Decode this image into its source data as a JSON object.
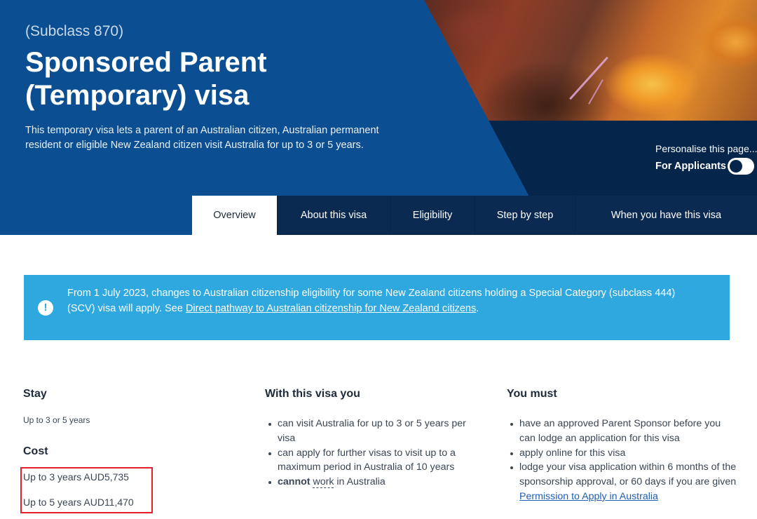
{
  "hero": {
    "subclass": "(Subclass 870)",
    "title": "Sponsored Parent (Temporary) visa",
    "description": "This temporary visa lets a parent of an Australian citizen, Australian permanent resident or eligible New Zealand citizen visit Australia for up to 3 or 5 years.",
    "personalise": "Personalise this page...",
    "audience_label": "For Applicants"
  },
  "tabs": [
    {
      "label": "Overview",
      "active": true
    },
    {
      "label": "About this visa",
      "active": false
    },
    {
      "label": "Eligibility",
      "active": false
    },
    {
      "label": "Step by step",
      "active": false
    },
    {
      "label": "When you have this visa",
      "active": false
    }
  ],
  "alert": {
    "icon": "exclamation-icon",
    "text": "From 1 July 2023, changes to Australian citizenship eligibility for some New Zealand citizens holding a Special Category (subclass 444) (SCV) visa will apply. See ",
    "link": "Direct pathway to Australian citizenship for New Zealand citizens",
    "suffix": "."
  },
  "stay": {
    "heading": "Stay",
    "value": "Up to 3 or 5 years"
  },
  "cost": {
    "heading": "Cost",
    "lines": [
      "Up to 3 years AUD5,735",
      "Up to 5 years AUD11,470"
    ]
  },
  "with_visa": {
    "heading": "With this visa you",
    "items": [
      "can visit Australia for up to 3 or 5 years per visa",
      "can apply for further visas to visit up to a maximum period in Australia of 10 years"
    ],
    "item3_bold": "cannot",
    "item3_term": "work",
    "item3_rest": " in Australia"
  },
  "you_must": {
    "heading": "You must",
    "items": [
      "have an approved Parent Sponsor before you can lodge an application for this visa",
      "apply online for this visa"
    ],
    "item3_text": "lodge your visa application within 6 months of the sponsorship approval, or 60 days if you are given ",
    "item3_link": "Permission to Apply in Australia"
  },
  "colors": {
    "hero_blue": "#0b4f92",
    "navy": "#06254a",
    "alert": "#2fa8df",
    "highlight": "#e5202a"
  }
}
